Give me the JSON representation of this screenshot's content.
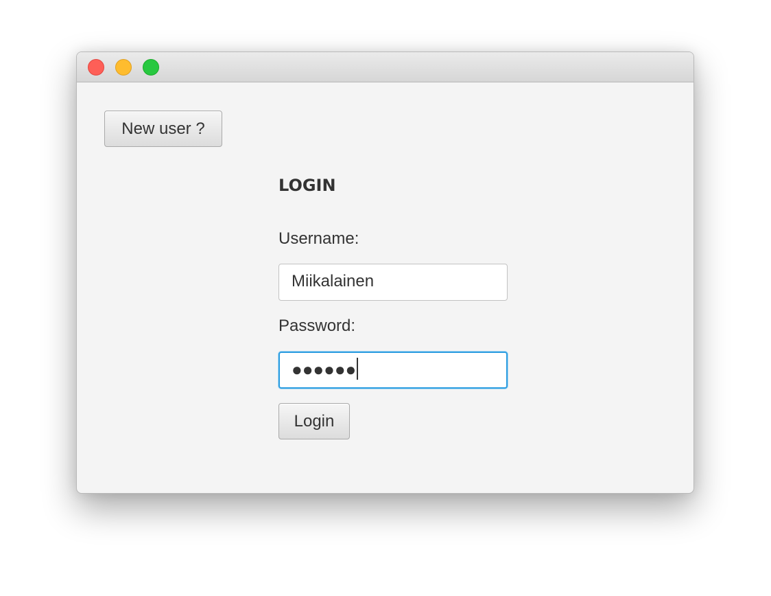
{
  "window": {
    "controls": [
      "close",
      "minimize",
      "zoom"
    ]
  },
  "new_user_button": "New user ?",
  "login_form": {
    "title": "LOGIN",
    "username_label": "Username:",
    "username_value": "Miikalainen",
    "password_label": "Password:",
    "password_masked": "●●●●●●",
    "login_button": "Login"
  },
  "colors": {
    "close": "#fe5f57",
    "minimize": "#febc2e",
    "zoom": "#28c840",
    "focus_border": "#2d9de0"
  }
}
